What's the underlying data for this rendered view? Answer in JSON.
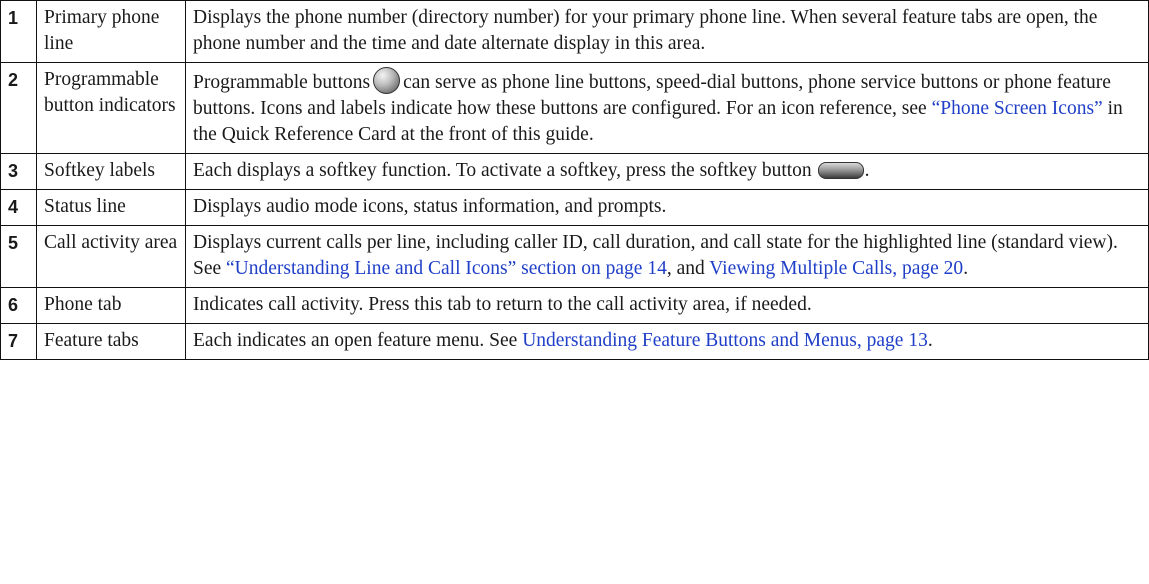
{
  "rows": [
    {
      "num": "1",
      "name": "Primary phone line",
      "desc": [
        "Displays the phone number (directory number) for your primary phone line. When several feature tabs are open, the phone number and the time and date alternate display in this area."
      ]
    },
    {
      "num": "2",
      "name": "Programmable button indicators",
      "desc": [
        "Programmable buttons",
        "can serve as phone line buttons, speed-dial buttons, phone service buttons or phone feature buttons. Icons and labels indicate how these buttons are configured. For an icon reference, see",
        "“Phone Screen Icons”",
        "in the Quick Reference Card at the front of this guide."
      ]
    },
    {
      "num": "3",
      "name": "Softkey labels",
      "desc": [
        "Each displays a softkey function. To activate a softkey, press the softkey button",
        "."
      ]
    },
    {
      "num": "4",
      "name": "Status line",
      "desc": [
        "Displays audio mode icons, status information, and prompts."
      ]
    },
    {
      "num": "5",
      "name": "Call activity area",
      "desc": [
        "Displays current calls per line, including caller ID, call duration, and call state for the highlighted line (standard view). See",
        "“Understanding Line and Call Icons” section on page 14",
        ", and",
        "Viewing Multiple Calls, page 20",
        "."
      ]
    },
    {
      "num": "6",
      "name": "Phone tab",
      "desc": [
        "Indicates call activity. Press this tab to return to the call activity area, if needed."
      ]
    },
    {
      "num": "7",
      "name": "Feature tabs",
      "desc": [
        "Each indicates an open feature menu. See",
        "Understanding Feature Buttons and Menus, page 13",
        "."
      ]
    }
  ],
  "icons": {
    "programmable_button": "round-button-icon",
    "softkey_button": "softkey-button-icon"
  },
  "colors": {
    "link": "#1f3fc8",
    "text": "#1a1a1a",
    "border": "#111111"
  }
}
